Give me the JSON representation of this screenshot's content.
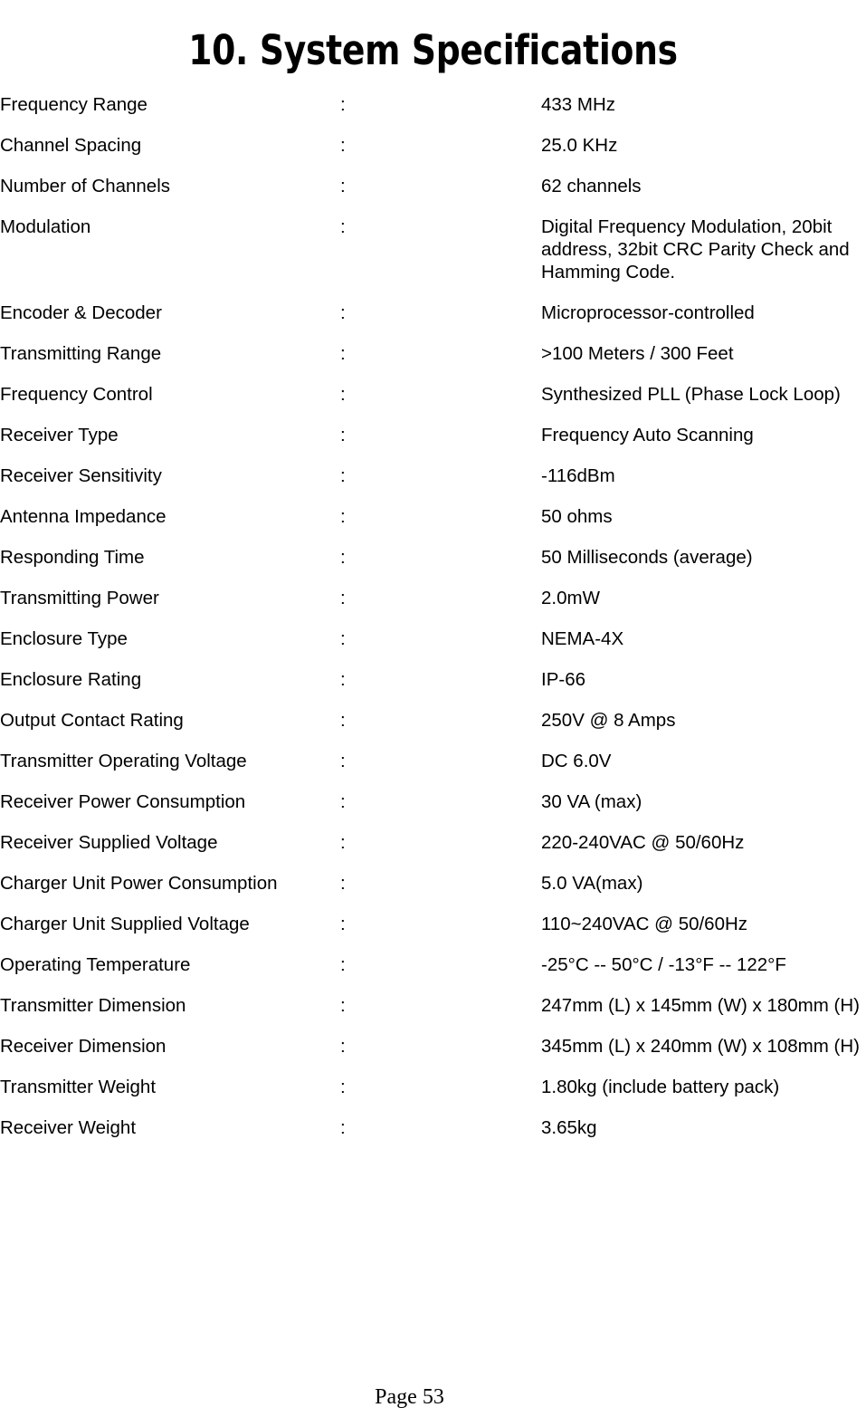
{
  "document": {
    "title": "10. System Specifications",
    "separator": ":",
    "footer": "Page 53"
  },
  "specs": [
    {
      "label": "Frequency Range",
      "value": "433 MHz"
    },
    {
      "label": "Channel Spacing",
      "value": "25.0 KHz"
    },
    {
      "label": "Number of Channels",
      "value": "62 channels"
    },
    {
      "label": "Modulation",
      "value": "Digital Frequency Modulation, 20bit\naddress, 32bit CRC Parity Check and\nHamming Code."
    },
    {
      "label": "Encoder & Decoder",
      "value": "Microprocessor-controlled"
    },
    {
      "label": "Transmitting Range",
      "value": ">100 Meters / 300 Feet"
    },
    {
      "label": "Frequency Control",
      "value": "Synthesized PLL (Phase Lock Loop)"
    },
    {
      "label": "Receiver Type",
      "value": "Frequency Auto Scanning"
    },
    {
      "label": "Receiver Sensitivity",
      "value": "-116dBm"
    },
    {
      "label": "Antenna Impedance",
      "value": "50 ohms"
    },
    {
      "label": "Responding Time",
      "value": "50 Milliseconds (average)"
    },
    {
      "label": "Transmitting Power",
      "value": "2.0mW"
    },
    {
      "label": "Enclosure Type",
      "value": "NEMA-4X"
    },
    {
      "label": "Enclosure Rating",
      "value": "IP-66"
    },
    {
      "label": "Output Contact Rating",
      "value": "250V @ 8 Amps"
    },
    {
      "label": "Transmitter Operating Voltage",
      "value": "DC 6.0V"
    },
    {
      "label": "Receiver Power Consumption",
      "value": "30 VA (max)"
    },
    {
      "label": "Receiver Supplied Voltage",
      "value": "220-240VAC @ 50/60Hz"
    },
    {
      "label": "Charger Unit Power Consumption",
      "value": "5.0 VA(max)"
    },
    {
      "label": "Charger Unit Supplied Voltage",
      "value": "110~240VAC @ 50/60Hz"
    },
    {
      "label": "Operating Temperature",
      "value": "-25°C -- 50°C / -13°F -- 122°F"
    },
    {
      "label": "Transmitter Dimension",
      "value": "247mm (L) x 145mm (W) x 180mm (H)"
    },
    {
      "label": "Receiver Dimension",
      "value": "345mm (L) x 240mm (W) x 108mm (H)"
    },
    {
      "label": "Transmitter Weight",
      "value": "1.80kg (include battery pack)"
    },
    {
      "label": "Receiver Weight",
      "value": "3.65kg"
    }
  ]
}
